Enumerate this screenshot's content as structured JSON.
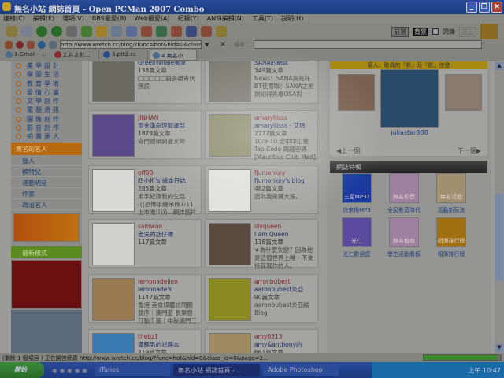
{
  "window": {
    "title": "無名小站 網誌首頁 - Open PCMan 2007 Combo",
    "min": "_",
    "max": "❐",
    "close": "✕"
  },
  "menu": [
    "連線(C)",
    "編輯(E)",
    "選項(V)",
    "BBS最愛(B)",
    "Web最愛(A)",
    "紀錄(Y)",
    "ANSI編輯(N)",
    "工具(T)",
    "說明(H)"
  ],
  "toolbar": {
    "fg": "前景",
    "bg": "背景",
    "blink": "閃爍",
    "send": "送出"
  },
  "address": {
    "url": "http://www.wretch.cc/blog/?func=hot&hid=0&class_id=0&q",
    "search_label": "搜尋：",
    "search_value": ""
  },
  "tabs": [
    {
      "label": "1.Gmail - ..."
    },
    {
      "label": "2.台大批..."
    },
    {
      "label": "3.ptt2.cc"
    },
    {
      "label": "4.無名小..."
    }
  ],
  "sidebar": {
    "categories": [
      "美學設計",
      "學園生活",
      "教育學術",
      "愛情心事",
      "文學創作",
      "電腦通訊",
      "圖像創作",
      "影音創作",
      "拍賣達人"
    ],
    "celeb_header": "無名的名人",
    "celeb_items": [
      "藝人",
      "模特兒",
      "運動明星",
      "作家",
      "政治名人"
    ],
    "new_styles_header": "最新樣式"
  },
  "cards": [
    {
      "user": "",
      "title": "GreenWhale蛋筆",
      "count": "138篇文章",
      "desc": "□□□□□語多雜寄厌無誤"
    },
    {
      "user": "",
      "title": "SANA的網誌",
      "count": "349篇文章",
      "desc": "News！SANA高亮杆BT佳爾聯！SANA之前謝記得先看OSA對"
    },
    {
      "user": "JINHAN",
      "title": "鄧金漢命理閒運部",
      "count": "1879篇文章",
      "desc": "奇門遁甲開運大師"
    },
    {
      "user": "amaryllisss",
      "title": "amaryllisss - 艾瑪",
      "count": "2177篇文章",
      "desc": "10/9-10 全中中山堂 Tap Code 踢踏密碼 [Mauritius Club Med]"
    },
    {
      "user": "off60",
      "title": "四小折's 繪本日誌",
      "count": "285篇文章",
      "desc": "用手紀錄我的生活...(((恐怖手繪吊飾7-11上市嚕!!)))...網誌圖片"
    },
    {
      "user": "fjumonkey",
      "title": "fjumonkey's blog",
      "count": "482篇文章",
      "desc": "因為我是輔大猴。"
    },
    {
      "user": "samwoo",
      "title": "老吳的尪仔標",
      "count": "117篇文章",
      "desc": ""
    },
    {
      "user": "illyqueen",
      "title": "I am Queen",
      "count": "118篇文章",
      "desc": "★為什麼失戀？因為他是這個世界上唯一不支持我寫作的人。"
    },
    {
      "user": "lemonadellen",
      "title": "lemonade's",
      "count": "1147篇文章",
      "desc": "香港 美食媒體訪問圈 競序｜澳門遊 長樂齋 孖軸千蛋｜中秋澳門三"
    },
    {
      "user": "arronbubest",
      "title": "aaronbubest炎亞",
      "count": "90篇文章",
      "desc": "aaronbubest炎亞綸Blog"
    },
    {
      "user": "thebz1",
      "title": "滿豚男的滤趣本",
      "count": "219篇文章",
      "desc": ""
    },
    {
      "user": "amy0313",
      "title": "amy&anthony的",
      "count": "661篇文章",
      "desc": ""
    }
  ],
  "right": {
    "header": "藝人、歌員的『影』及『影』佳發",
    "featured_user": "juliastar888",
    "prev": "上一個",
    "next": "下一個",
    "section": "網誌特輯",
    "icons": [
      {
        "img": "三星MP3?",
        "label": "快來換MP3",
        "color": "#1a3aa0"
      },
      {
        "img": "無名影音",
        "label": "全民影音時代",
        "color": "#a080a0"
      },
      {
        "img": "無名活動",
        "label": "活動新玩法",
        "color": "#a09070"
      },
      {
        "img": "光仁",
        "label": "光仁歡迎您",
        "color": "#5a4aa0"
      },
      {
        "img": "無名格格",
        "label": "學生活動看板",
        "color": "#a080a0"
      },
      {
        "img": "相簿排行榜",
        "label": "相簿排行榜",
        "color": "#a07010"
      }
    ]
  },
  "status": {
    "text": "(剩餘 1 個項目 ) 正在開啓網頁 http://www.wretch.cc/blog/?func=hot&hid=0&class_id=0&page=2...",
    "progress": 0.95
  },
  "taskbar": {
    "start": "開始",
    "tasks": [
      "iTunes",
      "無名小站 網誌首頁 - ...",
      "Adobe Photoshop"
    ],
    "clock": "上午 10:47"
  }
}
